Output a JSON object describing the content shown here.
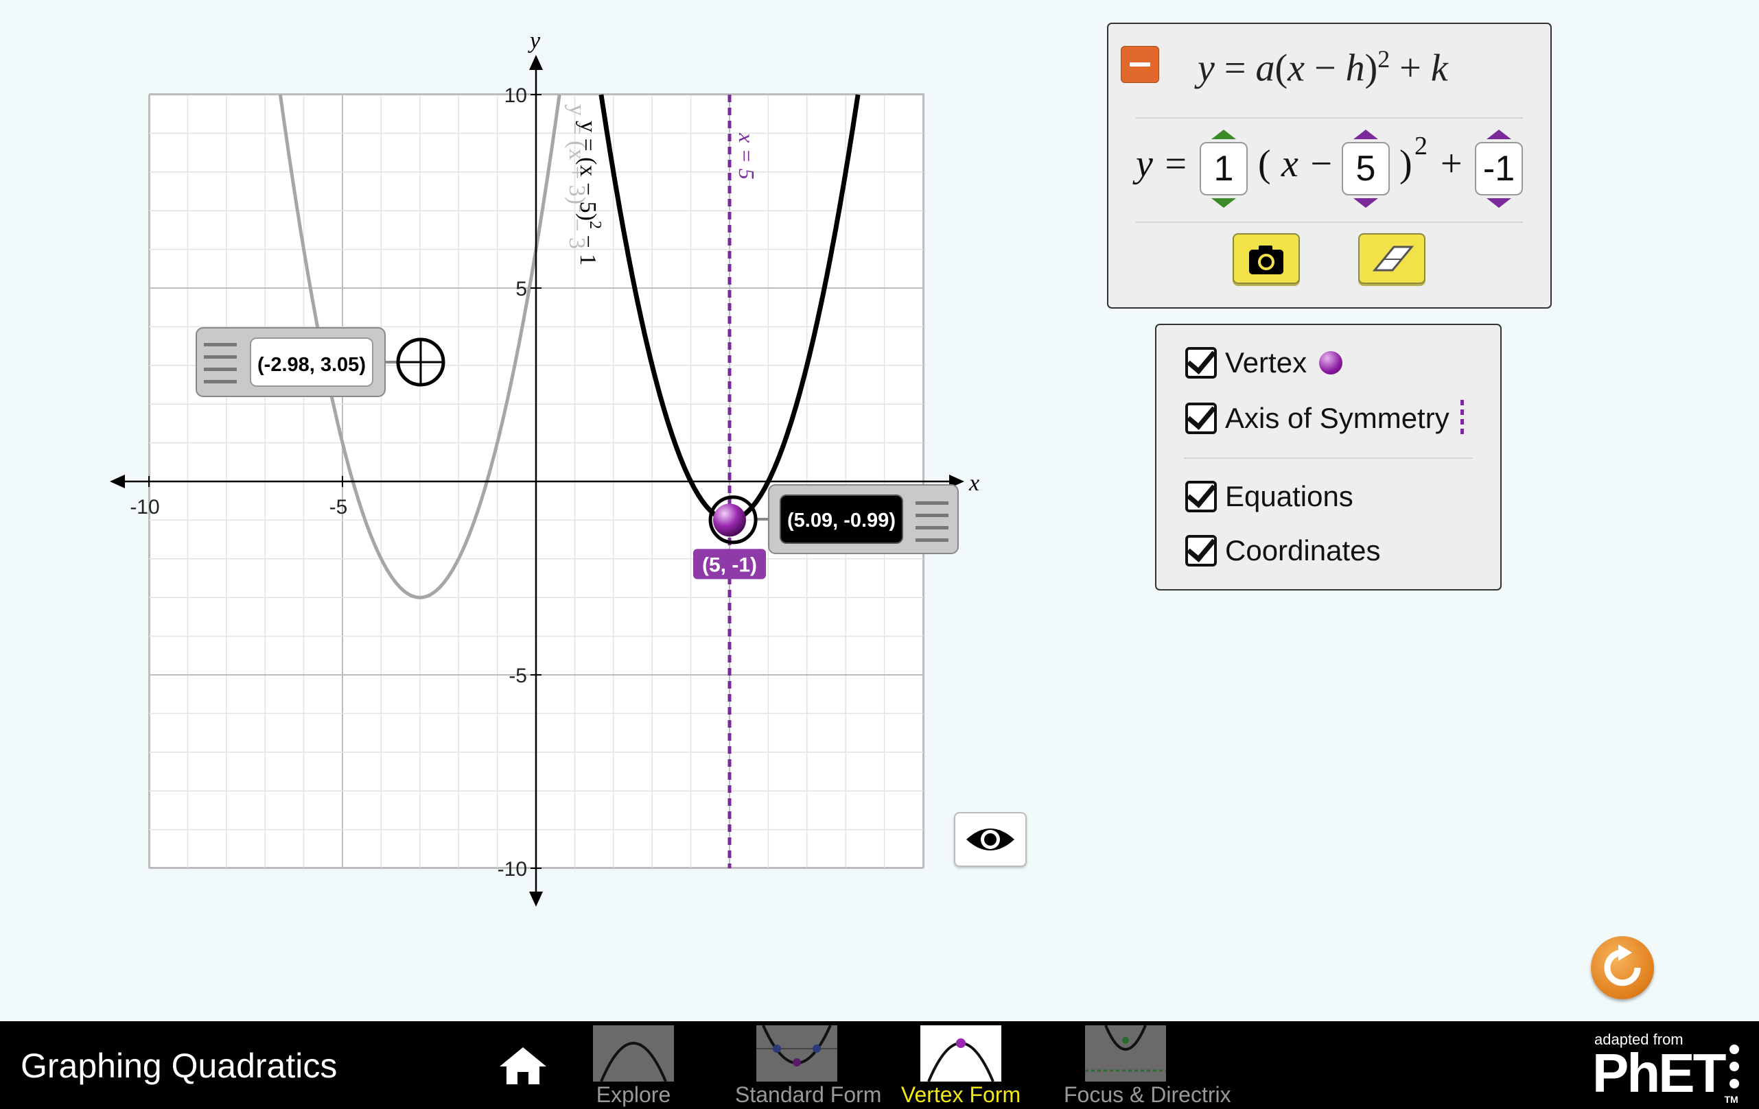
{
  "app": {
    "title": "Graphing Quadratics",
    "navbar": {
      "screens": [
        {
          "label": "Explore",
          "active": false
        },
        {
          "label": "Standard Form",
          "active": false
        },
        {
          "label": "Vertex Form",
          "active": true
        },
        {
          "label": "Focus & Directrix",
          "active": false
        }
      ],
      "brand_small": "adapted from",
      "brand_big": "PhET",
      "brand_tm": "TM"
    }
  },
  "equation_panel": {
    "general": {
      "y": "y",
      "eq": "=",
      "a": "a",
      "open": "(",
      "x": "x",
      "minus": "−",
      "h": "h",
      "close": ")",
      "exp": "2",
      "plus": "+",
      "k": "k"
    },
    "interactive": {
      "y_label": "y =",
      "open": "(",
      "x_minus": "x −",
      "close": ")",
      "exp": "2",
      "plus": "+",
      "a": "1",
      "h": "5",
      "k": "-1",
      "a_color": "#3a8a2a",
      "hk_color": "#7a2a9a"
    }
  },
  "options": {
    "vertex": "Vertex",
    "axis_of_symmetry": "Axis of Symmetry",
    "equations": "Equations",
    "coordinates": "Coordinates",
    "checked": {
      "vertex": true,
      "axis_of_symmetry": true,
      "equations": true,
      "coordinates": true
    }
  },
  "graph": {
    "x_axis_label": "x",
    "y_axis_label": "y",
    "x_ticks": [
      {
        "value": -10,
        "label": "-10"
      },
      {
        "value": -5,
        "label": "-5"
      }
    ],
    "y_ticks": [
      {
        "value": 10,
        "label": "10"
      },
      {
        "value": 5,
        "label": "5"
      },
      {
        "value": -5,
        "label": "-5"
      },
      {
        "value": -10,
        "label": "-10"
      }
    ],
    "xlim": [
      -10,
      10
    ],
    "ylim": [
      -10,
      10
    ],
    "grid": true,
    "active_curve": {
      "a": 1,
      "h": 5,
      "k": -1,
      "label_main": "y = (x − 5)",
      "label_exp": "2",
      "label_tail": " − 1",
      "color": "#000000"
    },
    "saved_curve": {
      "a": 1,
      "h": -3,
      "k": -3,
      "label_main": "y = (x + 3)",
      "label_exp": "2",
      "label_tail": " − 3",
      "color": "#a6a6a6"
    },
    "axis_of_symmetry": {
      "x": 5,
      "label": "x = 5",
      "color": "#7a2a9a"
    },
    "vertex": {
      "x": 5,
      "y": -1,
      "label": "(5, -1)"
    },
    "point_tool_1": {
      "x": -2.98,
      "y": 3.05,
      "label": "(-2.98, 3.05)"
    },
    "point_tool_2": {
      "x": 5.09,
      "y": -0.99,
      "label": "(5.09, -0.99)"
    }
  }
}
